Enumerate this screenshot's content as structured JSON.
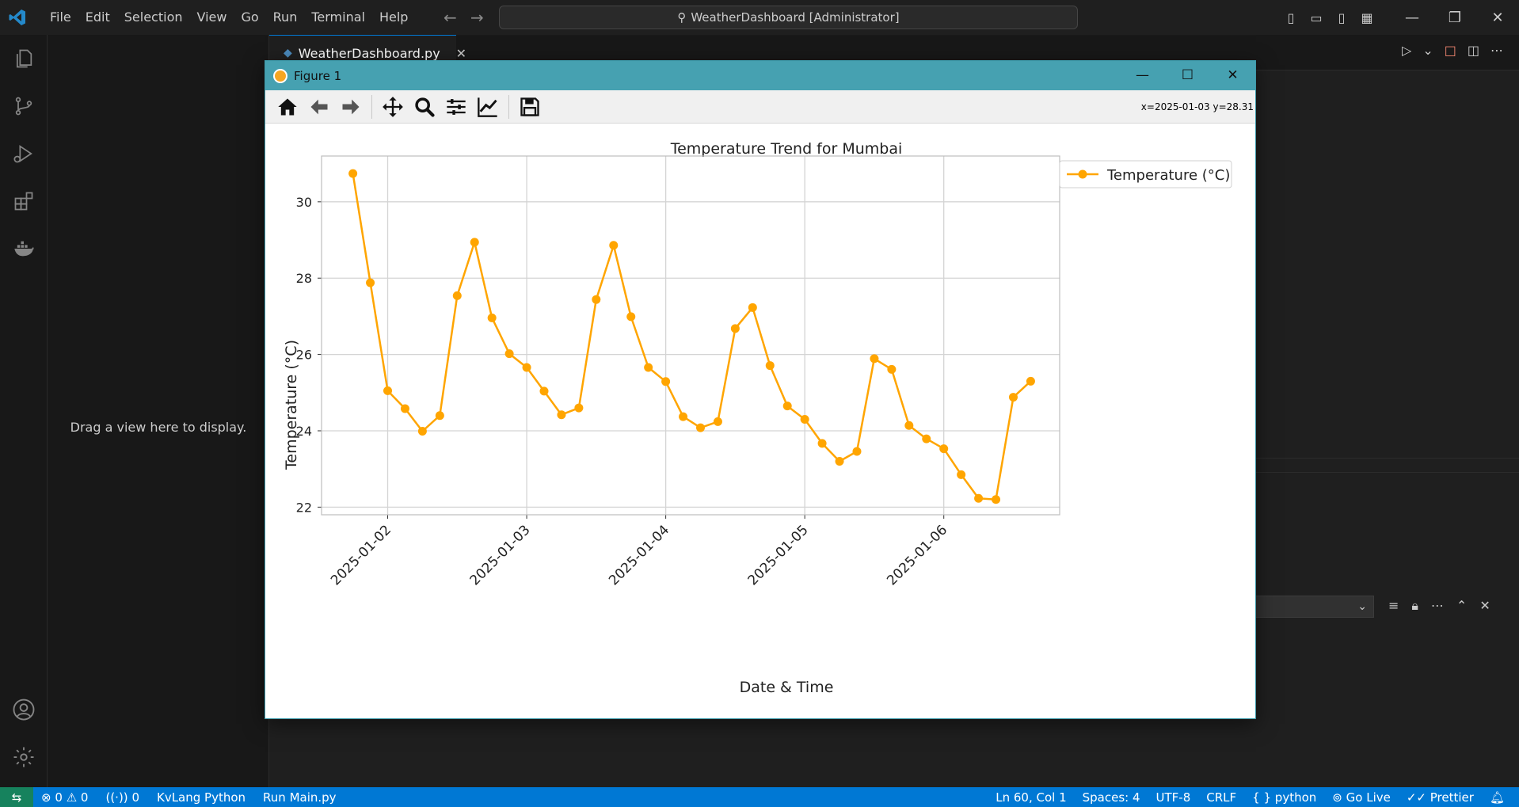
{
  "app": {
    "menu": [
      "File",
      "Edit",
      "Selection",
      "View",
      "Go",
      "Run",
      "Terminal",
      "Help"
    ],
    "command_center": "WeatherDashboard [Administrator]"
  },
  "sidebar": {
    "hint": "Drag a view here to display."
  },
  "editor": {
    "tab": "WeatherDashboard.py"
  },
  "figure": {
    "title": "Figure 1",
    "coord_readout": "x=2025-01-03 y=28.31"
  },
  "statusbar": {
    "errors": "0",
    "warnings": "0",
    "ports": "0",
    "lang_mode": "KvLang Python",
    "run": "Run Main.py",
    "cursor": "Ln 60, Col 1",
    "spaces": "Spaces: 4",
    "encoding": "UTF-8",
    "eol": "CRLF",
    "language": "python",
    "golive": "Go Live",
    "prettier": "Prettier"
  },
  "colors": {
    "series": "#ffa500",
    "accent": "#0078d4",
    "figure_titlebar": "#46a1b1"
  },
  "chart_data": {
    "type": "line",
    "title": "Temperature Trend for Mumbai",
    "xlabel": "Date & Time",
    "ylabel": "Temperature (°C)",
    "legend": "top-right",
    "grid": true,
    "xtick_labels": [
      "2025-01-02",
      "2025-01-03",
      "2025-01-04",
      "2025-01-05",
      "2025-01-06"
    ],
    "xlim": [
      "2025-01-01 12:35",
      "2025-01-06 20:00"
    ],
    "ylim": [
      21.8,
      31.2
    ],
    "yticks": [
      22,
      24,
      26,
      28,
      30
    ],
    "series": [
      {
        "name": "Temperature (°C)",
        "color": "#ffa500",
        "x": [
          "2025-01-01 18:00",
          "2025-01-01 21:00",
          "2025-01-02 00:00",
          "2025-01-02 03:00",
          "2025-01-02 06:00",
          "2025-01-02 09:00",
          "2025-01-02 12:00",
          "2025-01-02 15:00",
          "2025-01-02 18:00",
          "2025-01-02 21:00",
          "2025-01-03 00:00",
          "2025-01-03 03:00",
          "2025-01-03 06:00",
          "2025-01-03 09:00",
          "2025-01-03 12:00",
          "2025-01-03 15:00",
          "2025-01-03 18:00",
          "2025-01-03 21:00",
          "2025-01-04 00:00",
          "2025-01-04 03:00",
          "2025-01-04 06:00",
          "2025-01-04 09:00",
          "2025-01-04 12:00",
          "2025-01-04 15:00",
          "2025-01-04 18:00",
          "2025-01-04 21:00",
          "2025-01-05 00:00",
          "2025-01-05 03:00",
          "2025-01-05 06:00",
          "2025-01-05 09:00",
          "2025-01-05 12:00",
          "2025-01-05 15:00",
          "2025-01-05 18:00",
          "2025-01-05 21:00",
          "2025-01-06 00:00",
          "2025-01-06 03:00",
          "2025-01-06 06:00",
          "2025-01-06 09:00",
          "2025-01-06 12:00",
          "2025-01-06 15:00"
        ],
        "values": [
          30.74,
          27.88,
          25.05,
          24.58,
          23.99,
          24.4,
          27.54,
          28.94,
          26.96,
          26.02,
          25.66,
          25.04,
          24.42,
          24.6,
          27.44,
          28.86,
          26.99,
          25.66,
          25.29,
          24.37,
          24.08,
          24.24,
          26.68,
          27.23,
          25.71,
          24.65,
          24.3,
          23.67,
          23.2,
          23.46,
          25.89,
          25.61,
          24.14,
          23.79,
          23.53,
          22.85,
          22.23,
          22.2,
          24.88,
          25.3
        ]
      }
    ]
  }
}
